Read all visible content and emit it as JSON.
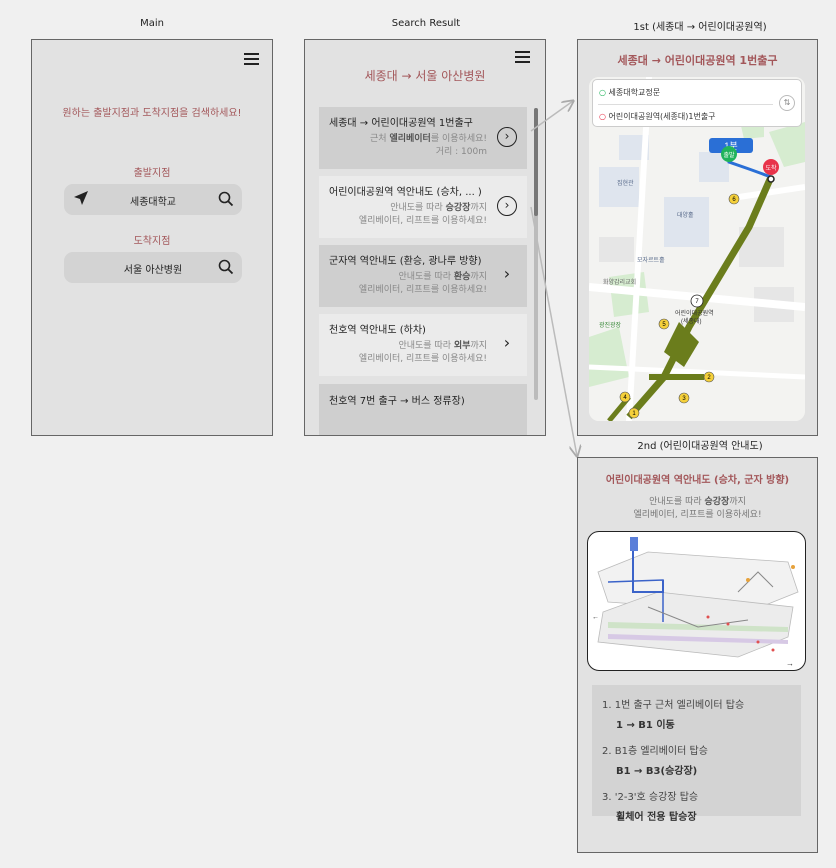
{
  "frames": {
    "main_label": "Main",
    "search_label": "Search Result",
    "first_label": "1st (세종대 → 어린이대공원역)",
    "second_label": "2nd (어린이대공원역 안내도)"
  },
  "main": {
    "prompt": "원하는 출발지점과 도착지점을 검색하세요!",
    "departure_label": "출발지점",
    "departure_value": "세종대학교",
    "arrival_label": "도착지점",
    "arrival_value": "서울 아산병원"
  },
  "search": {
    "title": "세종대 → 서울 아산병원",
    "results": [
      {
        "title": "세종대 → 어린이대공원역 1번출구",
        "line1_pre": "근처 ",
        "line1_bold": "엘리베이터",
        "line1_post": "를 이용하세요!",
        "line2": "거리 : 100m"
      },
      {
        "title": "어린이대공원역 역안내도 (승차, ... )",
        "line1_pre": "안내도를 따라 ",
        "line1_bold": "승강장",
        "line1_post": "까지",
        "line2": "엘리베이터, 리프트를 이용하세요!"
      },
      {
        "title": "군자역 역안내도 (환승, 광나루 방향)",
        "line1_pre": "안내도를 따라 ",
        "line1_bold": "환승",
        "line1_post": "까지",
        "line2": "엘리베이터, 리프트를 이용하세요!"
      },
      {
        "title": "천호역 역안내도 (하차)",
        "line1_pre": "안내도를 따라 ",
        "line1_bold": "외부",
        "line1_post": "까지",
        "line2": "엘리베이터, 리프트를 이용하세요!"
      },
      {
        "title": "천호역 7번 출구 → 버스 정류장)"
      }
    ]
  },
  "first": {
    "title": "세종대 → 어린이대공원역 1번출구",
    "from": "세종대학교정문",
    "to": "어린이대공원역(세종대)1번출구",
    "map_labels": {
      "building1": "집현관",
      "building2": "대양홀",
      "building3": "모자르트홀",
      "church": "화양감리교회",
      "square": "광진광장",
      "station": "어린이대공원역",
      "station_sub": "(세종대)",
      "walk_badge": "1분",
      "start_pin": "출발",
      "end_pin": "도착",
      "n1": "1",
      "n2": "2",
      "n3": "3",
      "n4": "4",
      "n5": "5",
      "n6": "6",
      "n7": "7"
    }
  },
  "second": {
    "title": "어린이대공원역 역안내도 (승차, 군자 방향)",
    "desc_pre": "안내도를 따라 ",
    "desc_bold": "승강장",
    "desc_post": "까지",
    "desc_line2": "엘리베이터, 리프트를 이용하세요!",
    "steps": [
      {
        "main": "1. 1번 출구 근처 엘리베이터 탑승",
        "sub": "1 → B1 이동"
      },
      {
        "main": "2. B1층 엘리베이터 탑승",
        "sub": "B1 → B3(승강장)"
      },
      {
        "main": "3. '2-3'호 승강장 탑승",
        "sub": "휠체어 전용 탑승장"
      }
    ]
  },
  "colors": {
    "accent": "#a3575a",
    "route": "#6b7d1c",
    "start": "#21b35b",
    "end": "#e8334a",
    "walk": "#2a6fd6"
  }
}
